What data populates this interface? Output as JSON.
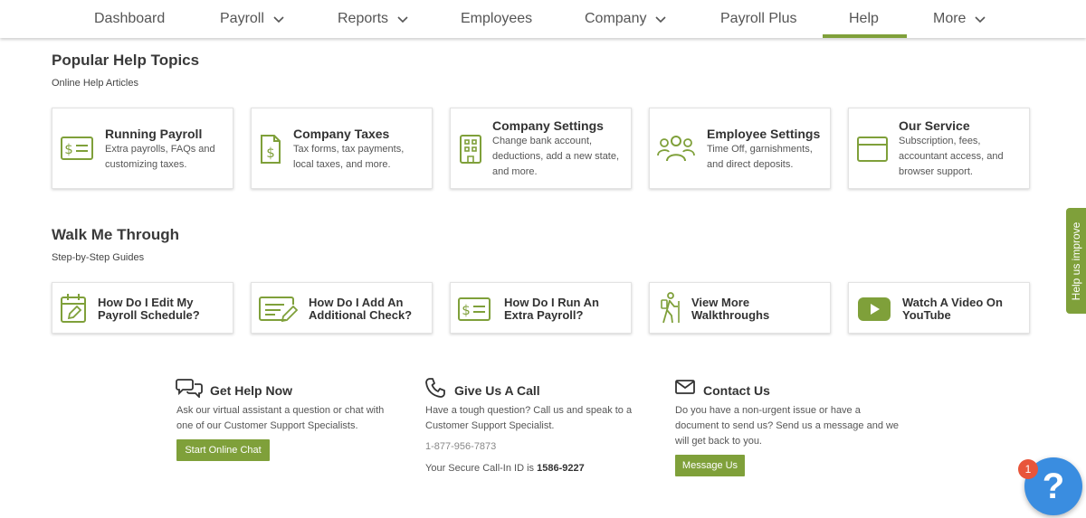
{
  "nav": {
    "items": [
      {
        "label": "Dashboard",
        "dropdown": false
      },
      {
        "label": "Payroll",
        "dropdown": true
      },
      {
        "label": "Reports",
        "dropdown": true
      },
      {
        "label": "Employees",
        "dropdown": false
      },
      {
        "label": "Company",
        "dropdown": true
      },
      {
        "label": "Payroll Plus",
        "dropdown": false
      },
      {
        "label": "Help",
        "dropdown": false,
        "active": true
      },
      {
        "label": "More",
        "dropdown": true
      }
    ]
  },
  "popular": {
    "title": "Popular Help Topics",
    "subtitle": "Online Help Articles",
    "cards": [
      {
        "icon": "dollar-bill-icon",
        "title": "Running Payroll",
        "desc": "Extra payrolls, FAQs and customizing taxes."
      },
      {
        "icon": "tax-document-icon",
        "title": "Company Taxes",
        "desc": "Tax forms, tax payments, local taxes, and more."
      },
      {
        "icon": "building-icon",
        "title": "Company Settings",
        "desc": "Change bank account, deductions, add a new state, and more."
      },
      {
        "icon": "people-icon",
        "title": "Employee Settings",
        "desc": "Time Off, garnishments, and direct deposits."
      },
      {
        "icon": "browser-window-icon",
        "title": "Our Service",
        "desc": "Subscription, fees, accountant access, and browser support."
      }
    ]
  },
  "walk": {
    "title": "Walk Me Through",
    "subtitle": "Step-by-Step Guides",
    "cards": [
      {
        "icon": "calendar-edit-icon",
        "line1": "How Do I Edit My",
        "line2": "Payroll Schedule?"
      },
      {
        "icon": "check-edit-icon",
        "line1": "How Do I Add An",
        "line2": "Additional Check?"
      },
      {
        "icon": "dollar-bill-icon",
        "line1": "How Do I Run An",
        "line2": "Extra Payroll?"
      },
      {
        "icon": "hiker-icon",
        "line1": "View More",
        "line2": "Walkthroughs"
      },
      {
        "icon": "youtube-play-icon",
        "line1": "Watch A Video On",
        "line2": "YouTube"
      }
    ]
  },
  "contact": {
    "chat": {
      "title": "Get Help Now",
      "text1": "Ask our virtual assistant a question or chat with",
      "text2": "one of our Customer Support Specialists.",
      "button": "Start Online Chat"
    },
    "call": {
      "title": "Give Us A Call",
      "text1": "Have a tough question? Call us and speak to a",
      "text2": "Customer Support Specialist.",
      "phone": "1-877-956-7873",
      "callin_prefix": "Your Secure Call-In ID is ",
      "callin_id": "1586-9227"
    },
    "message": {
      "title": "Contact Us",
      "text1": "Do you have a non-urgent issue or have a",
      "text2": "document to send us? Send us a message and we",
      "text3": "will get back to you.",
      "button": "Message Us"
    }
  },
  "side_tab": "Help us improve",
  "help_bubble": {
    "symbol": "?",
    "badge": "1"
  },
  "colors": {
    "accent": "#7fa03a",
    "bubble": "#3a8de0",
    "badge": "#e8553a"
  }
}
